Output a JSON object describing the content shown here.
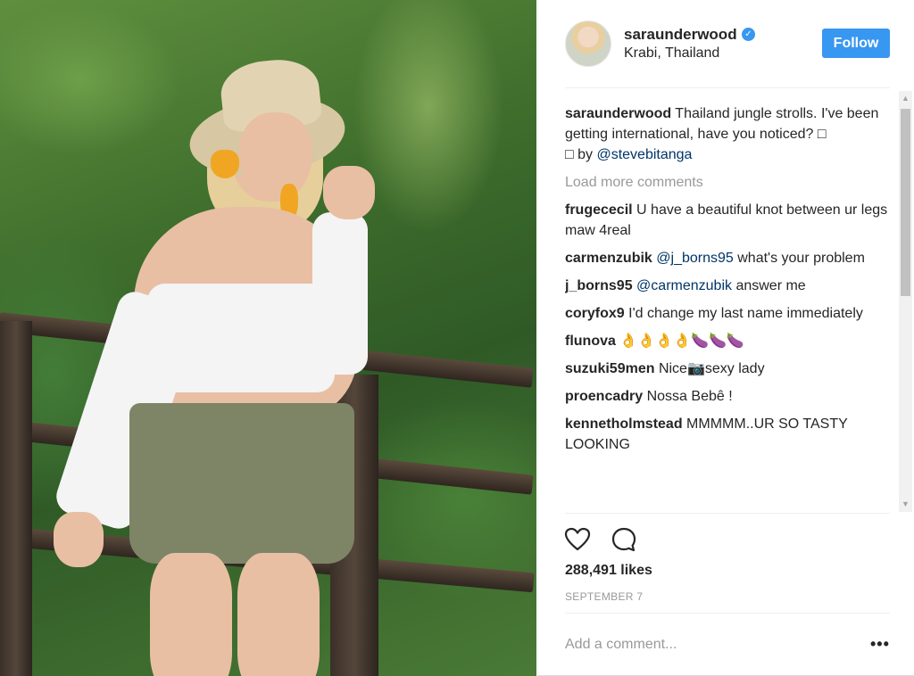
{
  "post": {
    "username": "saraunderwood",
    "location": "Krabi, Thailand",
    "follow_label": "Follow",
    "verified_mark": "✓"
  },
  "caption": {
    "user": "saraunderwood",
    "text_before_mention": "Thailand jungle strolls. I've been getting international, have you noticed? □",
    "text_line2": "□ by",
    "mention": "@stevebitanga"
  },
  "load_more_label": "Load more comments",
  "comments": [
    {
      "user": "frugececil",
      "mention": "",
      "text": "U have a beautiful knot between ur legs maw 4real"
    },
    {
      "user": "carmenzubik",
      "mention": "@j_borns95",
      "text": "what's your problem"
    },
    {
      "user": "j_borns95",
      "mention": "@carmenzubik",
      "text": "answer me"
    },
    {
      "user": "coryfox9",
      "mention": "",
      "text": "I'd change my last name immediately"
    },
    {
      "user": "flunova",
      "mention": "",
      "text": "👌👌👌👌🍆🍆🍆"
    },
    {
      "user": "suzuki59men",
      "mention": "",
      "text": "Nice📷sexy lady"
    },
    {
      "user": "proencadry",
      "mention": "",
      "text": "Nossa Bebê !"
    },
    {
      "user": "kennetholmstead",
      "mention": "",
      "text": "MMMMM..UR SO TASTY LOOKING"
    }
  ],
  "likes": "288,491 likes",
  "date": "SEPTEMBER 7",
  "add_comment_placeholder": "Add a comment...",
  "more_options": "•••",
  "icons": {
    "like": "heart-icon",
    "comment": "comment-icon",
    "options": "more-options-icon"
  },
  "colors": {
    "accent": "#3897f0",
    "mention": "#003569",
    "muted": "#999999",
    "text": "#262626"
  }
}
